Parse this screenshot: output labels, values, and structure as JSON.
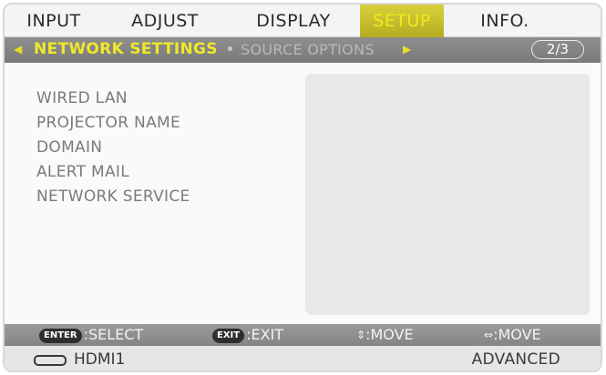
{
  "tabs": [
    {
      "label": "INPUT",
      "active": false
    },
    {
      "label": "ADJUST",
      "active": false
    },
    {
      "label": "DISPLAY",
      "active": false
    },
    {
      "label": "SETUP",
      "active": true
    },
    {
      "label": "INFO.",
      "active": false
    }
  ],
  "subtabs": {
    "current": "NETWORK SETTINGS",
    "next": "SOURCE OPTIONS",
    "page": "2/3"
  },
  "menu_items": [
    "WIRED LAN",
    "PROJECTOR NAME",
    "DOMAIN",
    "ALERT MAIL",
    "NETWORK SERVICE"
  ],
  "help": {
    "enter_key": "ENTER",
    "enter_label": ":SELECT",
    "exit_key": "EXIT",
    "exit_label": ":EXIT",
    "move_v_glyph": "⇕",
    "move_v_label": ":MOVE",
    "move_h_glyph": "⇔",
    "move_h_label": ":MOVE"
  },
  "status": {
    "source": "HDMI1",
    "mode": "ADVANCED"
  },
  "colors": {
    "active_tab_text": "#f4e81d",
    "active_subtab_text": "#f0e82a",
    "subbar_bg": "#858585"
  },
  "icons": {
    "source": "hdmi-port-icon",
    "scroll_left": "triangle-left-icon",
    "scroll_right": "triangle-right-icon"
  }
}
